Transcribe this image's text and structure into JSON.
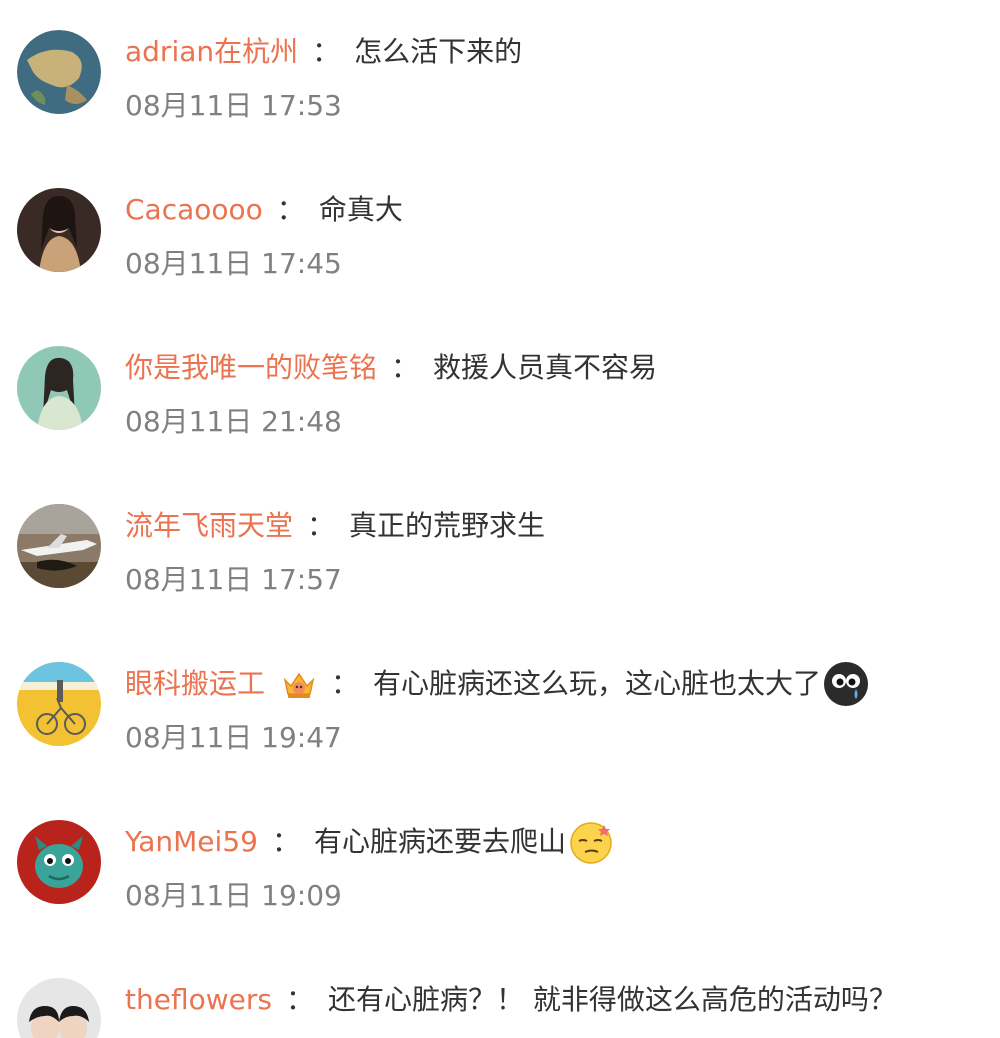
{
  "comments": [
    {
      "user": "adrian在杭州",
      "colon": "：",
      "text": "怎么活下来的",
      "time": "08月11日 17:53",
      "avatar": "globe-avatar"
    },
    {
      "user": "Cacaoooo",
      "colon": "：",
      "text": "命真大",
      "time": "08月11日 17:45",
      "avatar": "portrait-avatar"
    },
    {
      "user": "你是我唯一的败笔铭",
      "colon": "：",
      "text": "救援人员真不容易",
      "time": "08月11日 21:48",
      "avatar": "portrait-avatar"
    },
    {
      "user": "流年飞雨天堂",
      "colon": "：",
      "text": "真正的荒野求生",
      "time": "08月11日 17:57",
      "avatar": "airplane-avatar"
    },
    {
      "user": "眼科搬运工",
      "colon": "：",
      "text": "有心脏病还这么玩，这心脏也太大了",
      "time": "08月11日 19:47",
      "avatar": "bicycle-avatar",
      "badge": "crown-badge-icon",
      "emoji": "crying-face-emoji-icon"
    },
    {
      "user": "YanMei59",
      "colon": "：",
      "text": "有心脏病还要去爬山",
      "time": "08月11日 19:09",
      "avatar": "dragon-avatar",
      "emoji": "dizzy-face-emoji-icon"
    },
    {
      "user": "theflowers",
      "colon": "：",
      "text": "还有心脏病？！ 就非得做这么高危的活动吗？",
      "time": "",
      "avatar": "portrait-avatar"
    }
  ],
  "colors": {
    "username": "#eb7350",
    "text": "#333333",
    "time": "#808080"
  }
}
